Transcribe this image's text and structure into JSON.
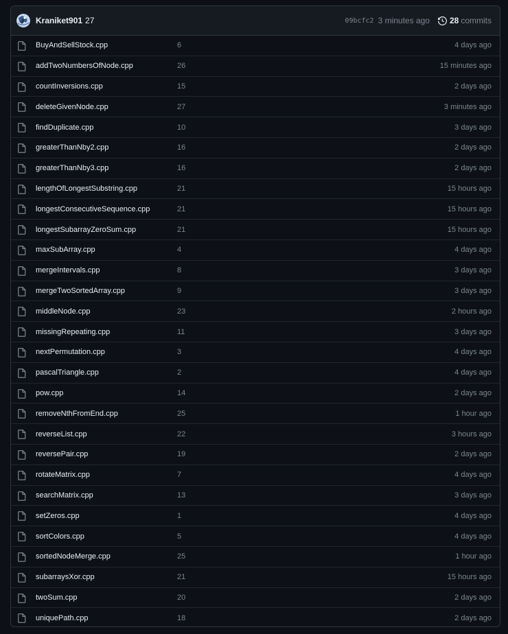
{
  "latest_commit": {
    "author": "Kraniket901",
    "message": "27",
    "sha": "09bcfc2",
    "time": "3 minutes ago",
    "commit_count": "28",
    "commits_label": "commits"
  },
  "files": [
    {
      "name": "BuyAndSellStock.cpp",
      "message": "6",
      "time": "4 days ago"
    },
    {
      "name": "addTwoNumbersOfNode.cpp",
      "message": "26",
      "time": "15 minutes ago"
    },
    {
      "name": "countInversions.cpp",
      "message": "15",
      "time": "2 days ago"
    },
    {
      "name": "deleteGivenNode.cpp",
      "message": "27",
      "time": "3 minutes ago"
    },
    {
      "name": "findDuplicate.cpp",
      "message": "10",
      "time": "3 days ago"
    },
    {
      "name": "greaterThanNby2.cpp",
      "message": "16",
      "time": "2 days ago"
    },
    {
      "name": "greaterThanNby3.cpp",
      "message": "16",
      "time": "2 days ago"
    },
    {
      "name": "lengthOfLongestSubstring.cpp",
      "message": "21",
      "time": "15 hours ago"
    },
    {
      "name": "longestConsecutiveSequence.cpp",
      "message": "21",
      "time": "15 hours ago"
    },
    {
      "name": "longestSubarrayZeroSum.cpp",
      "message": "21",
      "time": "15 hours ago"
    },
    {
      "name": "maxSubArray.cpp",
      "message": "4",
      "time": "4 days ago"
    },
    {
      "name": "mergeIntervals.cpp",
      "message": "8",
      "time": "3 days ago"
    },
    {
      "name": "mergeTwoSortedArray.cpp",
      "message": "9",
      "time": "3 days ago"
    },
    {
      "name": "middleNode.cpp",
      "message": "23",
      "time": "2 hours ago"
    },
    {
      "name": "missingRepeating.cpp",
      "message": "11",
      "time": "3 days ago"
    },
    {
      "name": "nextPermutation.cpp",
      "message": "3",
      "time": "4 days ago"
    },
    {
      "name": "pascalTriangle.cpp",
      "message": "2",
      "time": "4 days ago"
    },
    {
      "name": "pow.cpp",
      "message": "14",
      "time": "2 days ago"
    },
    {
      "name": "removeNthFromEnd.cpp",
      "message": "25",
      "time": "1 hour ago"
    },
    {
      "name": "reverseList.cpp",
      "message": "22",
      "time": "3 hours ago"
    },
    {
      "name": "reversePair.cpp",
      "message": "19",
      "time": "2 days ago"
    },
    {
      "name": "rotateMatrix.cpp",
      "message": "7",
      "time": "4 days ago"
    },
    {
      "name": "searchMatrix.cpp",
      "message": "13",
      "time": "3 days ago"
    },
    {
      "name": "setZeros.cpp",
      "message": "1",
      "time": "4 days ago"
    },
    {
      "name": "sortColors.cpp",
      "message": "5",
      "time": "4 days ago"
    },
    {
      "name": "sortedNodeMerge.cpp",
      "message": "25",
      "time": "1 hour ago"
    },
    {
      "name": "subarraysXor.cpp",
      "message": "21",
      "time": "15 hours ago"
    },
    {
      "name": "twoSum.cpp",
      "message": "20",
      "time": "2 days ago"
    },
    {
      "name": "uniquePath.cpp",
      "message": "18",
      "time": "2 days ago"
    }
  ],
  "icons": {
    "file": "file-icon",
    "history": "history-icon",
    "avatar": "avatar"
  },
  "colors": {
    "background": "#0d1117",
    "header_bg": "#161b22",
    "border": "#30363d",
    "text": "#e6edf3",
    "muted": "#7d8590"
  }
}
